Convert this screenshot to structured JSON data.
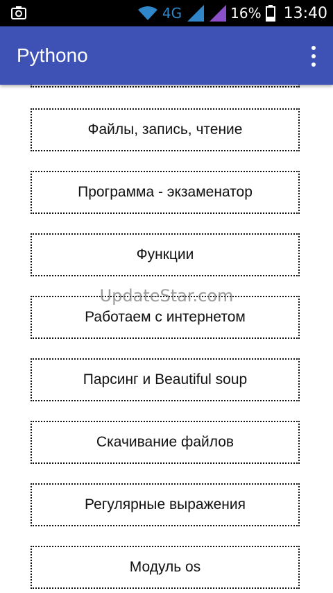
{
  "status_bar": {
    "network": "4G",
    "battery": "16%",
    "time": "13:40",
    "icons": [
      "camera-icon",
      "wifi-icon",
      "signal-icon",
      "signal-icon-2",
      "battery-icon"
    ]
  },
  "app_bar": {
    "title": "Pythono",
    "menu_icon": "overflow-menu-icon",
    "color": "#3d52b4"
  },
  "menu": {
    "items": [
      {
        "label": "Файлы, запись, чтение"
      },
      {
        "label": "Программа - экзаменатор"
      },
      {
        "label": "Функции"
      },
      {
        "label": "Работаем с интернетом"
      },
      {
        "label": "Парсинг и Beautiful soup"
      },
      {
        "label": "Скачивание файлов"
      },
      {
        "label": "Регулярные выражения"
      },
      {
        "label": "Модуль os"
      }
    ]
  },
  "watermark": "UpdateStar.com"
}
